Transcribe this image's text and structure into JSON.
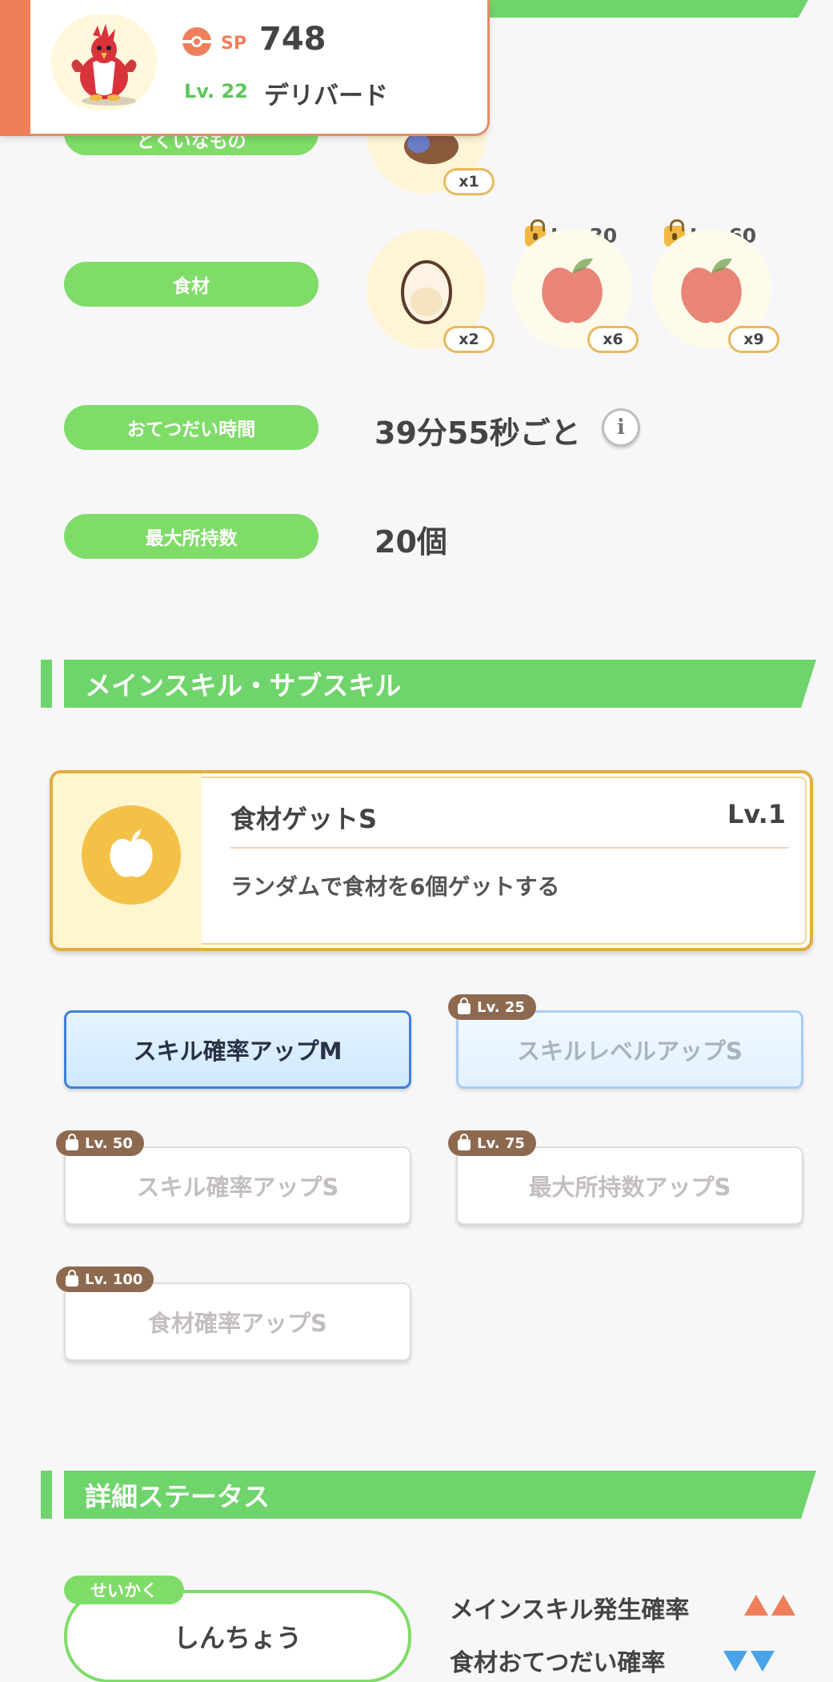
{
  "header": {
    "sp_label": "SP",
    "sp_value": "748",
    "level": "Lv. 22",
    "pokemon_name": "デリバード",
    "accent_color": "#ef7f5a"
  },
  "properties": {
    "partial_label": "とくいなもの",
    "berry_quantity": "x1",
    "ingredients_label": "食材",
    "ingredients": [
      {
        "name": "egg-icon",
        "quantity": "x2",
        "locked": false
      },
      {
        "name": "apple-icon",
        "quantity": "x6",
        "locked": true,
        "unlock_level": "Lv. 30"
      },
      {
        "name": "apple-icon",
        "quantity": "x9",
        "locked": true,
        "unlock_level": "Lv. 60"
      }
    ],
    "help_time_label": "おてつだい時間",
    "help_time_value": "39分55秒ごと",
    "info_icon": "i",
    "max_carry_label": "最大所持数",
    "max_carry_value": "20個"
  },
  "skills_section": {
    "title": "メインスキル・サブスキル",
    "main_skill": {
      "name": "食材ゲットS",
      "level": "Lv.1",
      "description": "ランダムで食材を6個ゲットする"
    },
    "sub_skills": [
      {
        "label": "スキル確率アップM",
        "state": "active"
      },
      {
        "label": "スキルレベルアップS",
        "unlock_level": "Lv. 25",
        "state": "locked"
      },
      {
        "label": "スキル確率アップS",
        "unlock_level": "Lv. 50",
        "state": "locked"
      },
      {
        "label": "最大所持数アップS",
        "unlock_level": "Lv. 75",
        "state": "locked"
      },
      {
        "label": "食材確率アップS",
        "unlock_level": "Lv. 100",
        "state": "locked"
      }
    ]
  },
  "detail_section": {
    "title": "詳細ステータス",
    "nature_tag": "せいかく",
    "nature_value": "しんちょう",
    "effects": [
      {
        "label": "メインスキル発生確率",
        "direction": "up",
        "color": "#ef7f5a"
      },
      {
        "label": "食材おてつだい確率",
        "direction": "down",
        "color": "#4aa3e8"
      }
    ]
  }
}
